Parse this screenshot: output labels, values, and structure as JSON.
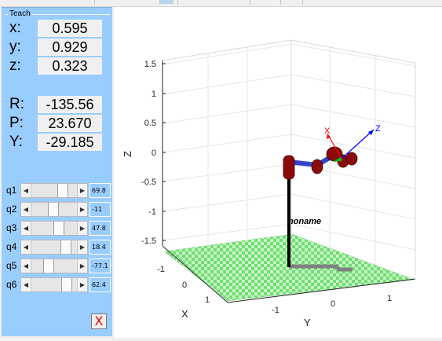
{
  "teach_panel": {
    "title": "Teach",
    "position": [
      {
        "label": "x:",
        "value": "0.595"
      },
      {
        "label": "y:",
        "value": "0.929"
      },
      {
        "label": "z:",
        "value": "0.323"
      }
    ],
    "orientation": [
      {
        "label": "R:",
        "value": "-135.56"
      },
      {
        "label": "P:",
        "value": "23.670"
      },
      {
        "label": "Y:",
        "value": "-29.185"
      }
    ],
    "joints": [
      {
        "label": "q1",
        "value": "69.8",
        "slider_fraction": 0.73
      },
      {
        "label": "q2",
        "value": "-11",
        "slider_fraction": 0.47
      },
      {
        "label": "q3",
        "value": "47.8",
        "slider_fraction": 0.63
      },
      {
        "label": "q4",
        "value": "18.4",
        "slider_fraction": 0.82
      },
      {
        "label": "q5",
        "value": "-77.1",
        "slider_fraction": 0.34
      },
      {
        "label": "q6",
        "value": "62.4",
        "slider_fraction": 0.85
      }
    ],
    "close_label": "X"
  },
  "plot": {
    "z_axis_label": "Z",
    "x_axis_label": "X",
    "y_axis_label": "Y",
    "z_ticks": [
      "1.5",
      "1",
      "0.5",
      "0",
      "-0.5",
      "-1",
      "-1.5"
    ],
    "x_ticks": [
      "-1",
      "0",
      "1"
    ],
    "y_ticks": [
      "-1",
      "0",
      "1"
    ],
    "robot_name": "noname",
    "frame_labels": {
      "x": "X",
      "z": "Z"
    },
    "colors": {
      "floor": "#6ee06e",
      "link": "#3344cc",
      "joint": "#8b0b0b",
      "shadow": "#808080",
      "frame_x": "#ff0000",
      "frame_y": "#00aa00",
      "frame_z": "#0000ff"
    }
  }
}
